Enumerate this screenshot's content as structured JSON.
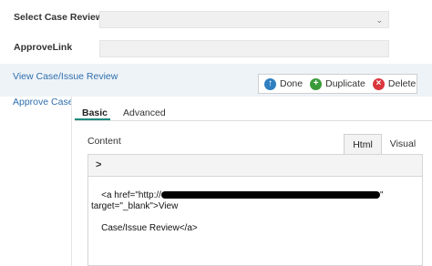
{
  "form": {
    "select_case_review_label": "Select Case Review",
    "select_case_review_value": "",
    "approvelink_label": "ApproveLink",
    "approvelink_value": ""
  },
  "links": {
    "view_case": "View Case/Issue Review",
    "approve_case": "Approve Case/"
  },
  "toolbar": {
    "done_label": "Done",
    "duplicate_label": "Duplicate",
    "delete_label": "Delete"
  },
  "tabs": {
    "basic": "Basic",
    "advanced": "Advanced"
  },
  "content": {
    "label": "Content",
    "html_tab": "Html",
    "visual_tab": "Visual",
    "editor_toggle": ">",
    "code_prefix": "<a href=\"http://",
    "code_suffix": "\" target=\"_blank\">View",
    "code_line2": "Case/Issue Review</a>"
  },
  "colors": {
    "done": "#2f7fc1",
    "duplicate": "#3a9a3a",
    "delete": "#d9363e",
    "tab_underline": "#1e8b7e",
    "link": "#2f6fad"
  },
  "icons": {
    "done": "arrow-up-circle-icon",
    "duplicate": "plus-circle-icon",
    "delete": "x-circle-icon",
    "dropdown": "chevron-down-icon"
  }
}
